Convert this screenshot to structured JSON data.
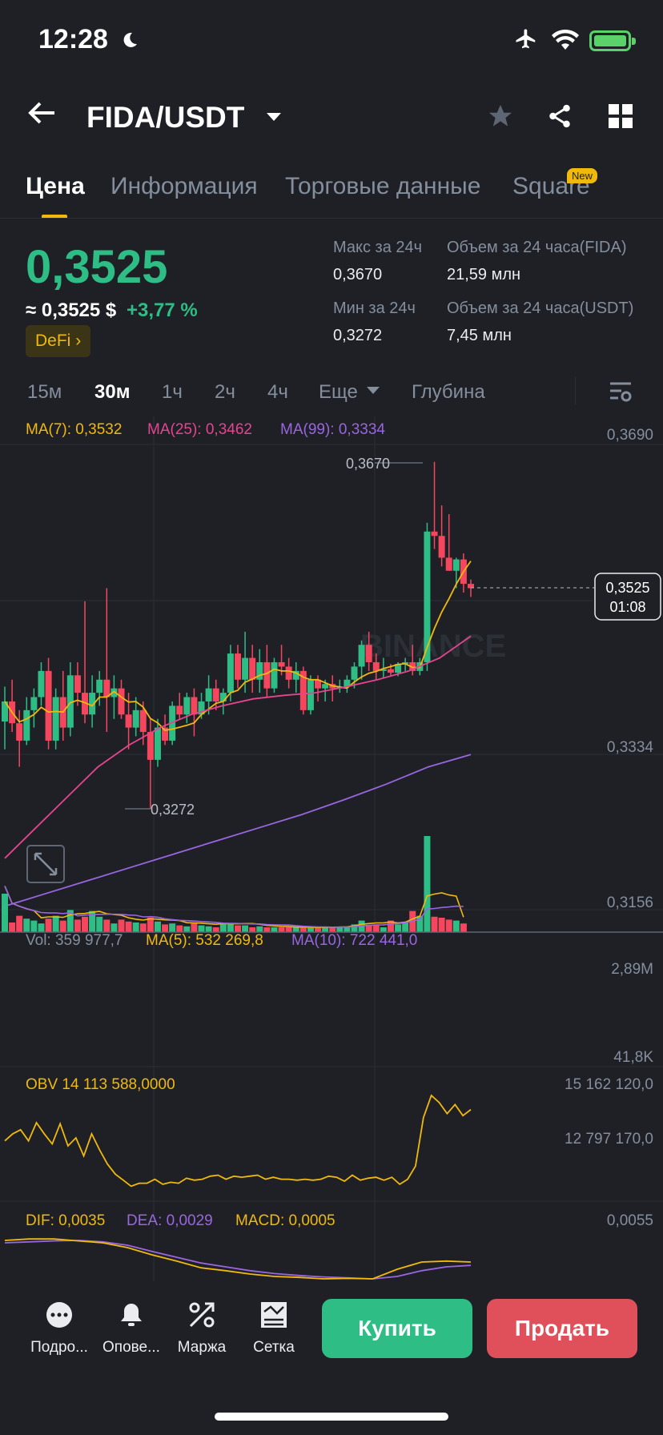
{
  "status": {
    "time": "12:28"
  },
  "header": {
    "pair": "FIDA/USDT"
  },
  "tabs": [
    {
      "label": "Цена"
    },
    {
      "label": "Информация"
    },
    {
      "label": "Торговые данные"
    },
    {
      "label": "Square"
    }
  ],
  "new_badge": "New",
  "price": {
    "last": "0,3525",
    "approx": "≈ 0,3525 $",
    "change": "+3,77 %",
    "tag": "DeFi"
  },
  "stats": {
    "high_label": "Макс за 24ч",
    "high": "0,3670",
    "low_label": "Мин за 24ч",
    "low": "0,3272",
    "vol_base_label": "Объем за 24 часа(FIDA)",
    "vol_base": "21,59 млн",
    "vol_quote_label": "Объем за 24 часа(USDT)",
    "vol_quote": "7,45 млн"
  },
  "intervals": [
    "15м",
    "30м",
    "1ч",
    "2ч",
    "4ч",
    "Еще",
    "Глубина"
  ],
  "indicators": {
    "ma7": "MA(7): 0,3532",
    "ma25": "MA(25): 0,3462",
    "ma99": "MA(99): 0,3334",
    "vol": "Vol: 359 977,7",
    "vol_ma5": "MA(5): 532 269,8",
    "vol_ma10": "MA(10): 722 441,0",
    "obv": "OBV 14 113 588,0000",
    "dif": "DIF: 0,0035",
    "dea": "DEA: 0,0029",
    "macd": "MACD: 0,0005"
  },
  "axis": {
    "p_top": "0,3690",
    "p_mid": "0,3334",
    "p_bot": "0,3156",
    "v_top": "2,89M",
    "v_bot": "41,8K",
    "obv_top": "15 162 120,0",
    "obv_mid": "12 797 170,0",
    "macd_top": "0,0055"
  },
  "annotations": {
    "high": "0,3670",
    "low": "0,3272",
    "current": "0,3525",
    "countdown": "01:08"
  },
  "colors": {
    "up": "#2ebd85",
    "down": "#f6465d",
    "ma7": "#f0b90b",
    "ma25": "#e5458e",
    "ma99": "#9966e0"
  },
  "chart_data": {
    "type": "candlestick",
    "ohlc": [
      [
        0.3372,
        0.3412,
        0.334,
        0.3395
      ],
      [
        0.3395,
        0.342,
        0.336,
        0.337
      ],
      [
        0.337,
        0.3385,
        0.332,
        0.335
      ],
      [
        0.335,
        0.34,
        0.3345,
        0.3385
      ],
      [
        0.3385,
        0.341,
        0.3365,
        0.34
      ],
      [
        0.34,
        0.344,
        0.339,
        0.343
      ],
      [
        0.343,
        0.3445,
        0.334,
        0.335
      ],
      [
        0.335,
        0.341,
        0.334,
        0.34
      ],
      [
        0.34,
        0.343,
        0.335,
        0.3365
      ],
      [
        0.3365,
        0.344,
        0.3355,
        0.3425
      ],
      [
        0.3425,
        0.344,
        0.339,
        0.3405
      ],
      [
        0.3405,
        0.351,
        0.337,
        0.338
      ],
      [
        0.338,
        0.3425,
        0.3365,
        0.3405
      ],
      [
        0.3405,
        0.343,
        0.339,
        0.342
      ],
      [
        0.342,
        0.3525,
        0.336,
        0.34
      ],
      [
        0.34,
        0.3425,
        0.3375,
        0.341
      ],
      [
        0.341,
        0.342,
        0.3375,
        0.338
      ],
      [
        0.338,
        0.3405,
        0.334,
        0.3365
      ],
      [
        0.3365,
        0.34,
        0.3355,
        0.3385
      ],
      [
        0.3385,
        0.3395,
        0.3345,
        0.336
      ],
      [
        0.336,
        0.3375,
        0.3272,
        0.3328
      ],
      [
        0.3328,
        0.3375,
        0.332,
        0.3365
      ],
      [
        0.3365,
        0.338,
        0.3345,
        0.335
      ],
      [
        0.335,
        0.3395,
        0.3345,
        0.339
      ],
      [
        0.339,
        0.3405,
        0.3375,
        0.338
      ],
      [
        0.338,
        0.3405,
        0.337,
        0.34
      ],
      [
        0.34,
        0.341,
        0.3355,
        0.338
      ],
      [
        0.338,
        0.3405,
        0.3375,
        0.3395
      ],
      [
        0.3395,
        0.3425,
        0.338,
        0.341
      ],
      [
        0.341,
        0.342,
        0.3385,
        0.3395
      ],
      [
        0.3395,
        0.341,
        0.338,
        0.3405
      ],
      [
        0.3405,
        0.346,
        0.3395,
        0.345
      ],
      [
        0.345,
        0.346,
        0.341,
        0.342
      ],
      [
        0.342,
        0.3475,
        0.3405,
        0.3445
      ],
      [
        0.3445,
        0.346,
        0.3405,
        0.342
      ],
      [
        0.342,
        0.3455,
        0.3405,
        0.344
      ],
      [
        0.344,
        0.346,
        0.34,
        0.341
      ],
      [
        0.341,
        0.3445,
        0.3405,
        0.344
      ],
      [
        0.344,
        0.346,
        0.3425,
        0.3435
      ],
      [
        0.3435,
        0.3445,
        0.341,
        0.342
      ],
      [
        0.342,
        0.344,
        0.3405,
        0.343
      ],
      [
        0.343,
        0.3435,
        0.338,
        0.3385
      ],
      [
        0.3385,
        0.3425,
        0.338,
        0.342
      ],
      [
        0.342,
        0.3425,
        0.3395,
        0.341
      ],
      [
        0.341,
        0.342,
        0.3395,
        0.3415
      ],
      [
        0.3415,
        0.3425,
        0.3395,
        0.341
      ],
      [
        0.341,
        0.342,
        0.3405,
        0.3412
      ],
      [
        0.3412,
        0.3425,
        0.3405,
        0.342
      ],
      [
        0.342,
        0.344,
        0.341,
        0.3435
      ],
      [
        0.3435,
        0.3465,
        0.342,
        0.346
      ],
      [
        0.346,
        0.3475,
        0.343,
        0.344
      ],
      [
        0.344,
        0.345,
        0.342,
        0.343
      ],
      [
        0.343,
        0.3445,
        0.3422,
        0.3432
      ],
      [
        0.3432,
        0.3438,
        0.3425,
        0.3428
      ],
      [
        0.3428,
        0.344,
        0.3424,
        0.3438
      ],
      [
        0.3438,
        0.3445,
        0.343,
        0.344
      ],
      [
        0.344,
        0.346,
        0.3425,
        0.343
      ],
      [
        0.343,
        0.3445,
        0.3425,
        0.344
      ],
      [
        0.344,
        0.36,
        0.343,
        0.359
      ],
      [
        0.359,
        0.367,
        0.357,
        0.3585
      ],
      [
        0.3585,
        0.362,
        0.355,
        0.356
      ],
      [
        0.356,
        0.361,
        0.3545,
        0.3545
      ],
      [
        0.3545,
        0.356,
        0.3525,
        0.3558
      ],
      [
        0.3558,
        0.3565,
        0.352,
        0.353
      ],
      [
        0.353,
        0.3535,
        0.3515,
        0.3525
      ]
    ],
    "volume": [
      0.4,
      0.1,
      0.17,
      0.14,
      0.12,
      0.09,
      0.14,
      0.17,
      0.12,
      0.23,
      0.13,
      0.16,
      0.22,
      0.16,
      0.13,
      0.09,
      0.13,
      0.11,
      0.1,
      0.09,
      0.15,
      0.11,
      0.08,
      0.09,
      0.07,
      0.06,
      0.1,
      0.07,
      0.06,
      0.05,
      0.09,
      0.09,
      0.07,
      0.07,
      0.05,
      0.06,
      0.04,
      0.05,
      0.05,
      0.04,
      0.04,
      0.04,
      0.04,
      0.04,
      0.05,
      0.04,
      0.05,
      0.05,
      0.08,
      0.12,
      0.07,
      0.08,
      0.05,
      0.12,
      0.08,
      0.1,
      0.22,
      0.17,
      1.0,
      0.16,
      0.15,
      0.13,
      0.12,
      0.09
    ],
    "price_axis": [
      0.3156,
      0.369
    ],
    "obv": [
      0.55,
      0.62,
      0.66,
      0.55,
      0.73,
      0.62,
      0.52,
      0.72,
      0.5,
      0.58,
      0.4,
      0.62,
      0.46,
      0.32,
      0.22,
      0.16,
      0.1,
      0.13,
      0.13,
      0.17,
      0.12,
      0.14,
      0.13,
      0.18,
      0.16,
      0.17,
      0.2,
      0.21,
      0.17,
      0.2,
      0.19,
      0.2,
      0.21,
      0.17,
      0.19,
      0.17,
      0.17,
      0.16,
      0.17,
      0.16,
      0.17,
      0.2,
      0.19,
      0.15,
      0.21,
      0.16,
      0.18,
      0.19,
      0.16,
      0.19,
      0.12,
      0.17,
      0.3,
      0.78,
      1.0,
      0.93,
      0.82,
      0.91,
      0.8,
      0.86
    ],
    "dif": [
      0.85,
      0.88,
      0.88,
      0.84,
      0.8,
      0.7,
      0.55,
      0.42,
      0.28,
      0.22,
      0.15,
      0.1,
      0.08,
      0.05,
      0.06,
      0.05,
      0.25,
      0.4,
      0.42,
      0.4
    ],
    "dea": [
      0.8,
      0.82,
      0.84,
      0.85,
      0.82,
      0.75,
      0.62,
      0.5,
      0.38,
      0.3,
      0.22,
      0.16,
      0.12,
      0.09,
      0.07,
      0.05,
      0.1,
      0.22,
      0.3,
      0.33
    ]
  },
  "bottom_nav": [
    {
      "label": "Подро..."
    },
    {
      "label": "Опове..."
    },
    {
      "label": "Маржа"
    },
    {
      "label": "Сетка"
    }
  ],
  "actions": {
    "buy": "Купить",
    "sell": "Продать"
  }
}
